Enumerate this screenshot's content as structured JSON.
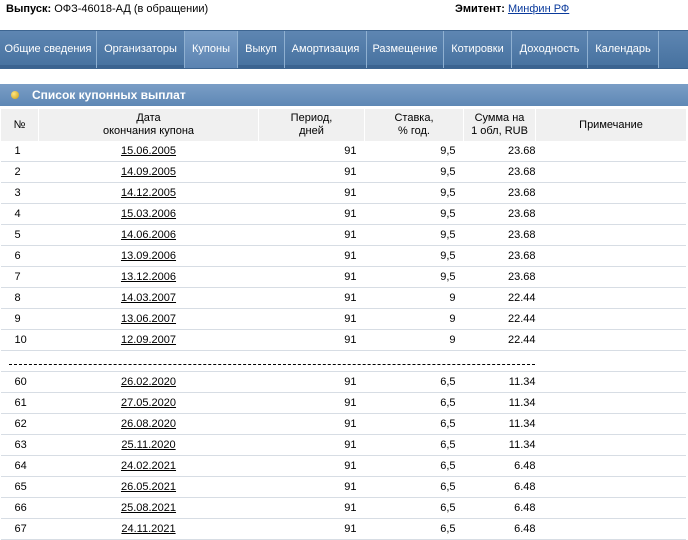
{
  "header": {
    "issue_label": "Выпуск:",
    "issue_value": "ОФЗ-46018-АД (в обращении)",
    "issuer_label": "Эмитент:",
    "issuer_link": "Минфин РФ"
  },
  "tabs": [
    {
      "label": "Общие сведения",
      "active": false
    },
    {
      "label": "Организаторы",
      "active": false
    },
    {
      "label": "Купоны",
      "active": true
    },
    {
      "label": "Выкуп",
      "active": false
    },
    {
      "label": "Амортизация",
      "active": false
    },
    {
      "label": "Размещение",
      "active": false
    },
    {
      "label": "Котировки",
      "active": false
    },
    {
      "label": "Доходность",
      "active": false
    },
    {
      "label": "Календарь",
      "active": false
    }
  ],
  "section_title": "Список купонных выплат",
  "table": {
    "headers": {
      "num": "№",
      "date_l1": "Дата",
      "date_l2": "окончания купона",
      "period_l1": "Период,",
      "period_l2": "дней",
      "rate_l1": "Ставка,",
      "rate_l2": "% год.",
      "sum_l1": "Сумма на",
      "sum_l2": "1 обл, RUB",
      "note": "Примечание"
    },
    "rows_top": [
      {
        "n": "1",
        "date": "15.06.2005",
        "period": "91",
        "rate": "9,5",
        "sum": "23.68"
      },
      {
        "n": "2",
        "date": "14.09.2005",
        "period": "91",
        "rate": "9,5",
        "sum": "23.68"
      },
      {
        "n": "3",
        "date": "14.12.2005",
        "period": "91",
        "rate": "9,5",
        "sum": "23.68"
      },
      {
        "n": "4",
        "date": "15.03.2006",
        "period": "91",
        "rate": "9,5",
        "sum": "23.68"
      },
      {
        "n": "5",
        "date": "14.06.2006",
        "period": "91",
        "rate": "9,5",
        "sum": "23.68"
      },
      {
        "n": "6",
        "date": "13.09.2006",
        "period": "91",
        "rate": "9,5",
        "sum": "23.68"
      },
      {
        "n": "7",
        "date": "13.12.2006",
        "period": "91",
        "rate": "9,5",
        "sum": "23.68"
      },
      {
        "n": "8",
        "date": "14.03.2007",
        "period": "91",
        "rate": "9",
        "sum": "22.44"
      },
      {
        "n": "9",
        "date": "13.06.2007",
        "period": "91",
        "rate": "9",
        "sum": "22.44"
      },
      {
        "n": "10",
        "date": "12.09.2007",
        "period": "91",
        "rate": "9",
        "sum": "22.44"
      }
    ],
    "rows_bottom": [
      {
        "n": "60",
        "date": "26.02.2020",
        "period": "91",
        "rate": "6,5",
        "sum": "11.34"
      },
      {
        "n": "61",
        "date": "27.05.2020",
        "period": "91",
        "rate": "6,5",
        "sum": "11.34"
      },
      {
        "n": "62",
        "date": "26.08.2020",
        "period": "91",
        "rate": "6,5",
        "sum": "11.34"
      },
      {
        "n": "63",
        "date": "25.11.2020",
        "period": "91",
        "rate": "6,5",
        "sum": "11.34"
      },
      {
        "n": "64",
        "date": "24.02.2021",
        "period": "91",
        "rate": "6,5",
        "sum": "6.48"
      },
      {
        "n": "65",
        "date": "26.05.2021",
        "period": "91",
        "rate": "6,5",
        "sum": "6.48"
      },
      {
        "n": "66",
        "date": "25.08.2021",
        "period": "91",
        "rate": "6,5",
        "sum": "6.48"
      },
      {
        "n": "67",
        "date": "24.11.2021",
        "period": "91",
        "rate": "6,5",
        "sum": "6.48"
      }
    ]
  }
}
